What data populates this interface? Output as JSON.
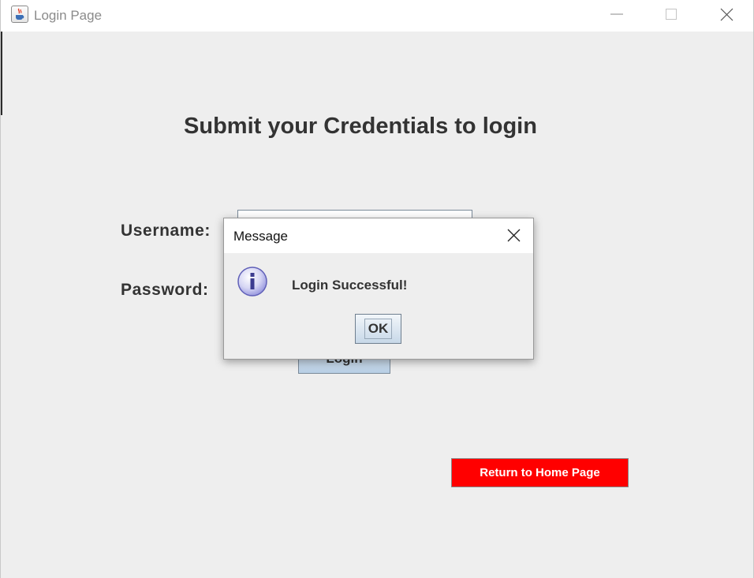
{
  "window": {
    "title": "Login Page",
    "app_icon": "java-cup-icon",
    "controls": {
      "minimize_icon": "minimize-icon",
      "maximize_icon": "maximize-icon",
      "close_icon": "close-icon"
    }
  },
  "form": {
    "heading": "Submit your Credentials to login",
    "username_label": "Username:",
    "username_value": "",
    "password_label": "Password:",
    "login_button_label": "Login",
    "home_button_label": "Return to Home Page",
    "home_button_color": "#ff0000"
  },
  "dialog": {
    "title": "Message",
    "icon": "info-icon",
    "message": "Login Successful!",
    "ok_label": "OK",
    "close_icon": "close-icon"
  },
  "colors": {
    "background": "#eeeeee",
    "heading_text": "#333333",
    "accent_red": "#ff0000"
  }
}
